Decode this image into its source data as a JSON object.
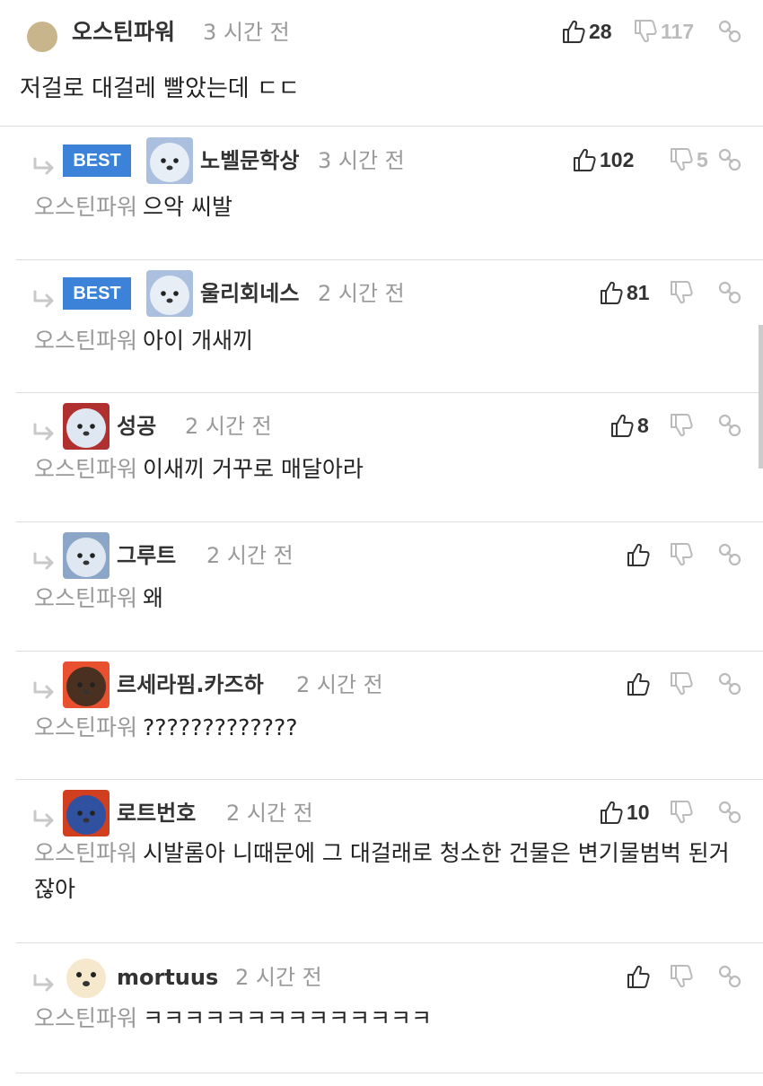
{
  "top_comment": {
    "author": "오스틴파워",
    "time": "3 시간 전",
    "likes": "28",
    "dislikes": "117",
    "body": "저걸로 대걸레 빨았는데 ㄷㄷ"
  },
  "badge_label": "BEST",
  "replies": [
    {
      "author": "노벨문학상",
      "time": "3 시간 전",
      "mention": "오스틴파워",
      "body": "으악 씨발",
      "likes": "102",
      "dislikes": "5",
      "best": true
    },
    {
      "author": "울리회네스",
      "time": "2 시간 전",
      "mention": "오스틴파워",
      "body": "아이 개새끼",
      "likes": "81",
      "dislikes": "",
      "best": true
    },
    {
      "author": "성공",
      "time": "2 시간 전",
      "mention": "오스틴파워",
      "body": "이새끼 거꾸로 매달아라",
      "likes": "8",
      "dislikes": "",
      "best": false
    },
    {
      "author": "그루트",
      "time": "2 시간 전",
      "mention": "오스틴파워",
      "body": "왜",
      "likes": "",
      "dislikes": "",
      "best": false
    },
    {
      "author": "르세라핌.카즈하",
      "time": "2 시간 전",
      "mention": "오스틴파워",
      "body": "?????????????",
      "likes": "",
      "dislikes": "",
      "best": false
    },
    {
      "author": "로트번호",
      "time": "2 시간 전",
      "mention": "오스틴파워",
      "body": "시발롬아 니때문에 그 대걸래로 청소한 건물은 변기물범벅 된거잖아",
      "likes": "10",
      "dislikes": "",
      "best": false
    },
    {
      "author": "mortuus",
      "time": "2 시간 전",
      "mention": "오스틴파워",
      "body": "ㅋㅋㅋㅋㅋㅋㅋㅋㅋㅋㅋㅋㅋㅋ",
      "likes": "",
      "dislikes": "",
      "best": false
    }
  ],
  "icons": {
    "like": "thumbs-up-icon",
    "dislike": "thumbs-down-icon",
    "link": "link-icon",
    "reply_arrow": "reply-arrow-icon"
  },
  "colors": {
    "badge": "#3b82d8",
    "muted": "#999999",
    "border": "#dddddd"
  }
}
